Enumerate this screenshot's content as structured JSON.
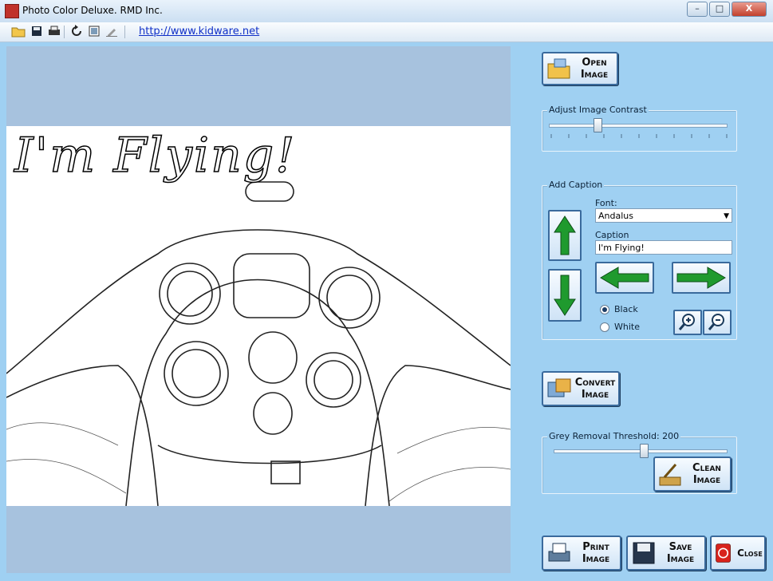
{
  "window": {
    "title": "Photo Color Deluxe.  RMD Inc.",
    "controls": {
      "minimize": "–",
      "maximize": "□",
      "close": "X"
    }
  },
  "toolbar": {
    "icons": [
      "open-folder-icon",
      "save-disk-icon",
      "print-icon",
      "rotate-icon",
      "image-icon",
      "pen-icon"
    ],
    "link": "http://www.kidware.net"
  },
  "image": {
    "caption": "I'm Flying!",
    "caption_color": "white"
  },
  "open_image_button": {
    "label": "Open Image"
  },
  "contrast": {
    "legend": "Adjust Image Contrast",
    "value": 0.27
  },
  "add_caption": {
    "legend": "Add Caption",
    "font_label": "Font:",
    "font_value": "Andalus",
    "caption_label": "Caption",
    "caption_value": "I'm Flying!",
    "radio_black": "Black",
    "radio_white": "White",
    "selected_color": "Black"
  },
  "convert_button": {
    "label_line1": "Convert",
    "label_line2": "Image"
  },
  "grey_removal": {
    "legend": "Grey Removal Threshold: 200",
    "value": 0.5
  },
  "clean_button": {
    "label_line1": "Clean",
    "label_line2": "Image"
  },
  "print_button": {
    "label_line1": "Print",
    "label_line2": "Image"
  },
  "save_button": {
    "label_line1": "Save",
    "label_line2": "Image"
  },
  "close_button": {
    "label": "Close"
  },
  "colors": {
    "panel_bg": "#9fd0f2",
    "canvas_bg": "#a7c2de",
    "arrow_green": "#1f9a2e"
  }
}
